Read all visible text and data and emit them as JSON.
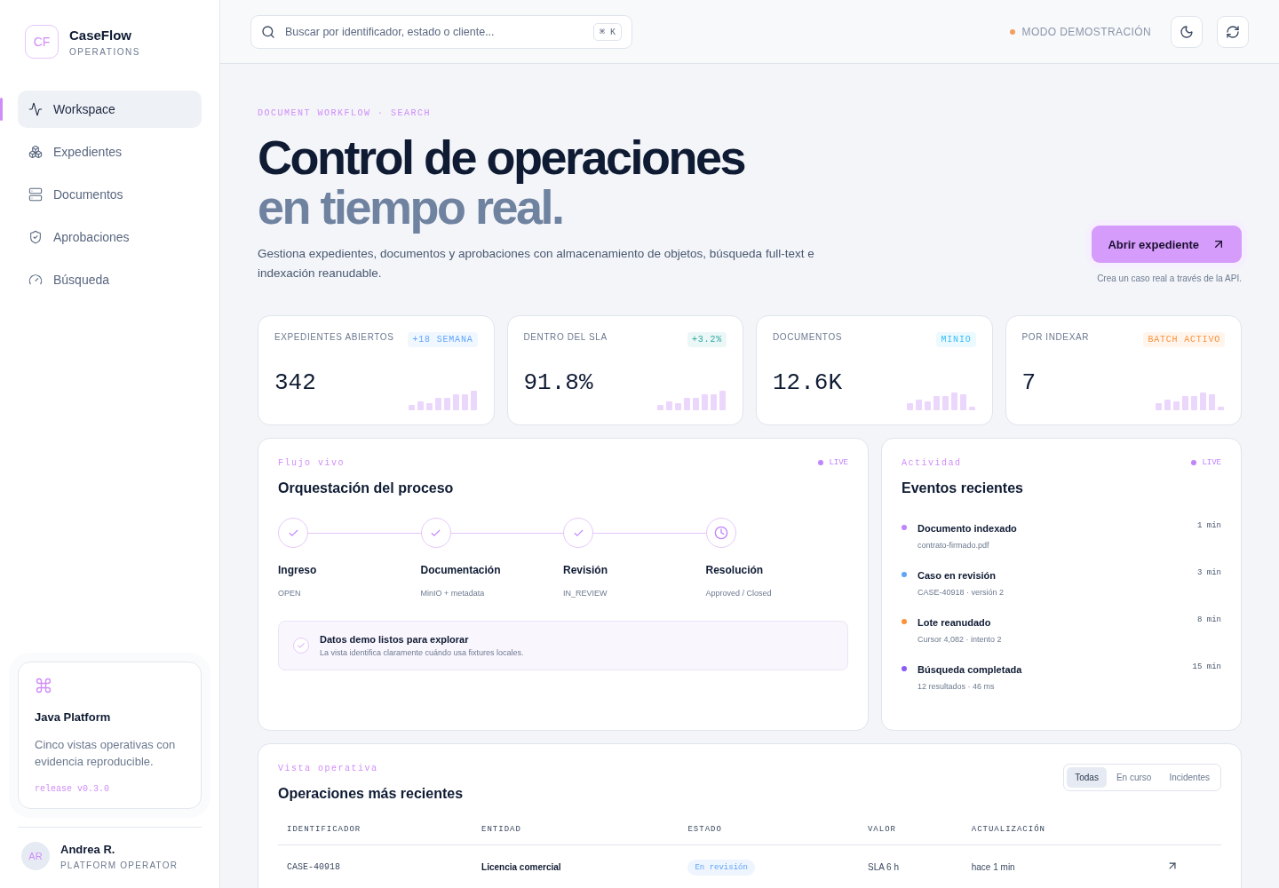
{
  "brand": {
    "logo": "CF",
    "name": "CaseFlow",
    "sub": "OPERATIONS"
  },
  "nav": [
    {
      "label": "Workspace",
      "selected": true
    },
    {
      "label": "Expedientes",
      "selected": false
    },
    {
      "label": "Documentos",
      "selected": false
    },
    {
      "label": "Aprobaciones",
      "selected": false
    },
    {
      "label": "Búsqueda",
      "selected": false
    }
  ],
  "promo": {
    "title": "Java Platform",
    "text": "Cinco vistas operativas con evidencia reproducible.",
    "release": "release v0.3.0"
  },
  "user": {
    "initials": "AR",
    "name": "Andrea R.",
    "role": "PLATFORM OPERATOR"
  },
  "search": {
    "placeholder": "Buscar por identificador, estado o cliente...",
    "shortcut": "⌘ K"
  },
  "mode": {
    "label": "MODO DEMOSTRACIÓN",
    "color": "#f0a060"
  },
  "hero": {
    "eyebrow": "DOCUMENT WORKFLOW · SEARCH",
    "title_line1": "Control de operaciones",
    "title_line2": "en tiempo real.",
    "description": "Gestiona expedientes, documentos y aprobaciones con almacenamiento de objetos, búsqueda full-text e indexación reanudable.",
    "button": "Abrir expediente",
    "note": "Crea un caso real a través de la API."
  },
  "stats": [
    {
      "label": "EXPEDIENTES ABIERTOS",
      "badge": "+18 SEMANA",
      "color": "#60a5fa",
      "value": "342"
    },
    {
      "label": "DENTRO DEL SLA",
      "badge": "+3.2%",
      "color": "#2aa6a0",
      "value": "91.8%"
    },
    {
      "label": "DOCUMENTOS",
      "badge": "MINIO",
      "color": "#38bdf8",
      "value": "12.6K"
    },
    {
      "label": "POR INDEXAR",
      "badge": "BATCH ACTIVO",
      "color": "#fb923c",
      "value": "7"
    }
  ],
  "process": {
    "eyebrow": "Flujo vivo",
    "live": "LIVE",
    "title": "Orquestación del proceso",
    "stages": [
      {
        "name": "Ingreso",
        "detail": "OPEN",
        "done": true
      },
      {
        "name": "Documentación",
        "detail": "MinIO + metadata",
        "done": true
      },
      {
        "name": "Revisión",
        "detail": "IN_REVIEW",
        "done": true
      },
      {
        "name": "Resolución",
        "detail": "Approved / Closed",
        "done": false
      }
    ],
    "notice": {
      "title": "Datos demo listos para explorar",
      "text": "La vista identifica claramente cuándo usa fixtures locales."
    }
  },
  "activity": {
    "eyebrow": "Actividad",
    "live": "LIVE",
    "title": "Eventos recientes",
    "events": [
      {
        "title": "Documento indexado",
        "detail": "contrato-firmado.pdf",
        "time": "1 min",
        "color": "#c084fc"
      },
      {
        "title": "Caso en revisión",
        "detail": "CASE-40918 · versión 2",
        "time": "3 min",
        "color": "#60a5fa"
      },
      {
        "title": "Lote reanudado",
        "detail": "Cursor 4,082 · intento 2",
        "time": "8 min",
        "color": "#fb923c"
      },
      {
        "title": "Búsqueda completada",
        "detail": "12 resultados · 46 ms",
        "time": "15 min",
        "color": "#8b5cf6"
      }
    ]
  },
  "operations": {
    "eyebrow": "Vista operativa",
    "title": "Operaciones más recientes",
    "filters": [
      {
        "label": "Todas",
        "selected": true
      },
      {
        "label": "En curso",
        "selected": false
      },
      {
        "label": "Incidentes",
        "selected": false
      }
    ],
    "columns": [
      "IDENTIFICADOR",
      "ENTIDAD",
      "ESTADO",
      "VALOR",
      "ACTUALIZACIÓN"
    ],
    "rows": [
      {
        "id": "CASE-40918",
        "entity": "Licencia comercial",
        "status": "En revisión",
        "value": "SLA 6 h",
        "updated": "hace 1 min"
      }
    ]
  }
}
